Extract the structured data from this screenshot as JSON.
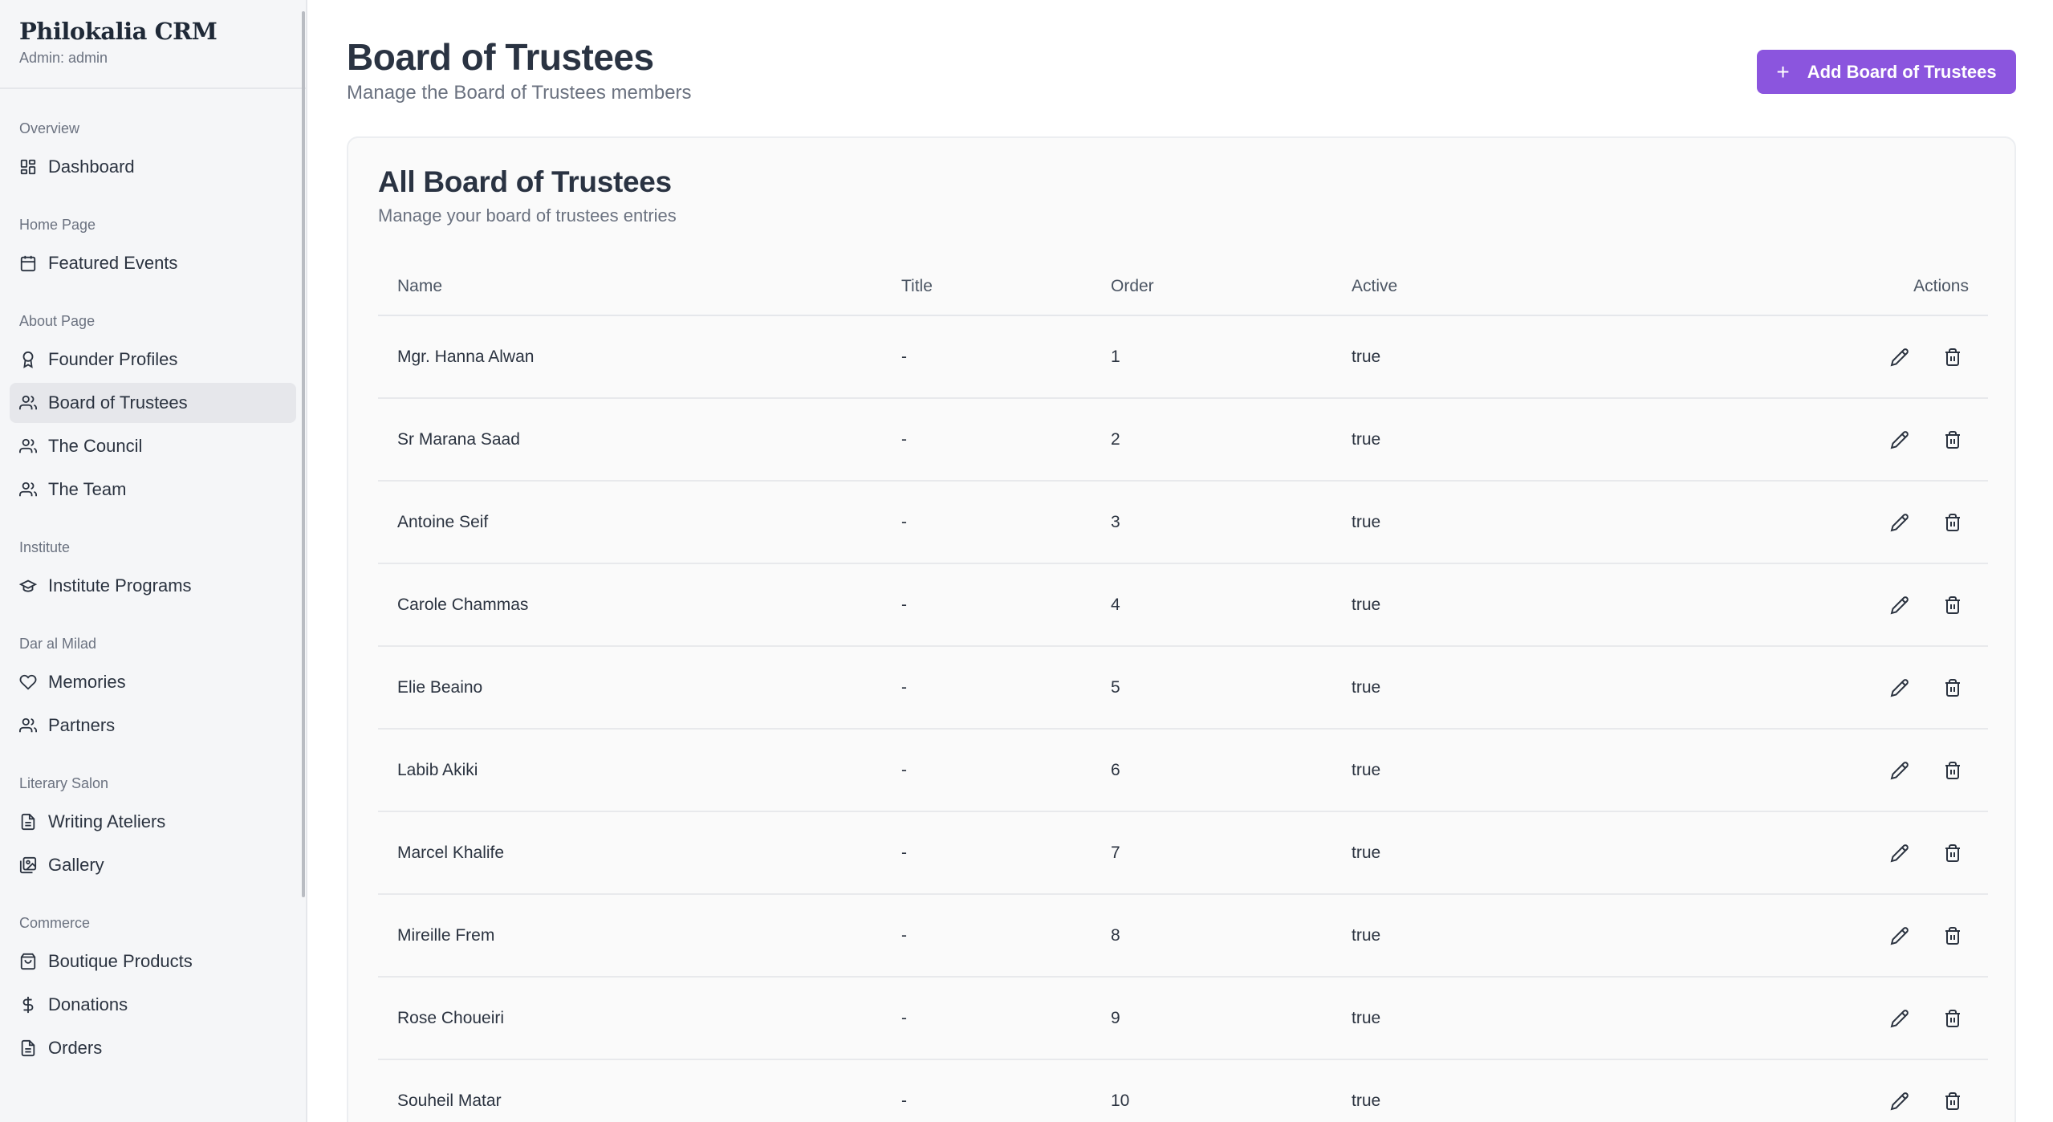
{
  "brand": {
    "title": "Philokalia CRM",
    "subtitle": "Admin: admin"
  },
  "sidebar": {
    "sections": [
      {
        "label": "Overview",
        "items": [
          {
            "label": "Dashboard",
            "icon": "dashboard-icon"
          }
        ]
      },
      {
        "label": "Home Page",
        "items": [
          {
            "label": "Featured Events",
            "icon": "calendar-icon"
          }
        ]
      },
      {
        "label": "About Page",
        "items": [
          {
            "label": "Founder Profiles",
            "icon": "award-icon"
          },
          {
            "label": "Board of Trustees",
            "icon": "users-icon",
            "active": true
          },
          {
            "label": "The Council",
            "icon": "users-icon"
          },
          {
            "label": "The Team",
            "icon": "users-icon"
          }
        ]
      },
      {
        "label": "Institute",
        "items": [
          {
            "label": "Institute Programs",
            "icon": "graduation-cap-icon"
          }
        ]
      },
      {
        "label": "Dar al Milad",
        "items": [
          {
            "label": "Memories",
            "icon": "heart-icon"
          },
          {
            "label": "Partners",
            "icon": "users-icon"
          }
        ]
      },
      {
        "label": "Literary Salon",
        "items": [
          {
            "label": "Writing Ateliers",
            "icon": "document-icon"
          },
          {
            "label": "Gallery",
            "icon": "images-icon"
          }
        ]
      },
      {
        "label": "Commerce",
        "items": [
          {
            "label": "Boutique Products",
            "icon": "shopping-bag-icon"
          },
          {
            "label": "Donations",
            "icon": "dollar-icon"
          },
          {
            "label": "Orders",
            "icon": "document-icon"
          }
        ]
      }
    ]
  },
  "header": {
    "title": "Board of Trustees",
    "subtitle": "Manage the Board of Trustees members",
    "add_label": "Add Board of Trustees"
  },
  "card": {
    "title": "All Board of Trustees",
    "subtitle": "Manage your board of trustees entries"
  },
  "table": {
    "columns": {
      "name": "Name",
      "title": "Title",
      "order": "Order",
      "active": "Active",
      "actions": "Actions"
    },
    "rows": [
      {
        "name": "Mgr. Hanna Alwan",
        "title": "-",
        "order": "1",
        "active": "true"
      },
      {
        "name": "Sr Marana Saad",
        "title": "-",
        "order": "2",
        "active": "true"
      },
      {
        "name": "Antoine Seif",
        "title": "-",
        "order": "3",
        "active": "true"
      },
      {
        "name": "Carole Chammas",
        "title": "-",
        "order": "4",
        "active": "true"
      },
      {
        "name": "Elie Beaino",
        "title": "-",
        "order": "5",
        "active": "true"
      },
      {
        "name": "Labib Akiki",
        "title": "-",
        "order": "6",
        "active": "true"
      },
      {
        "name": "Marcel Khalife",
        "title": "-",
        "order": "7",
        "active": "true"
      },
      {
        "name": "Mireille Frem",
        "title": "-",
        "order": "8",
        "active": "true"
      },
      {
        "name": "Rose Choueiri",
        "title": "-",
        "order": "9",
        "active": "true"
      },
      {
        "name": "Souheil Matar",
        "title": "-",
        "order": "10",
        "active": "true"
      }
    ]
  },
  "colors": {
    "accent": "#8b55de",
    "sidebar_bg": "#f5f6f8",
    "active_item_bg": "#e6e7eb"
  }
}
